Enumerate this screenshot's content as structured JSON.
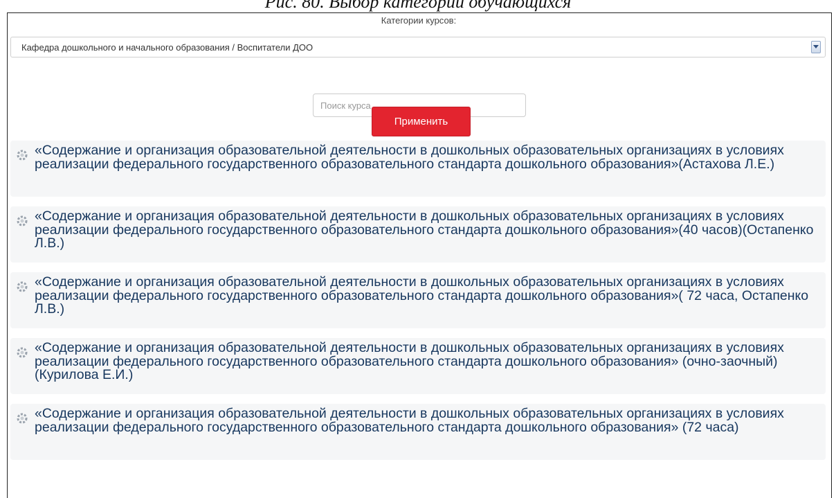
{
  "caption": "Рис. 80. Выбор категорий обучающихся",
  "filter": {
    "label": "Категории курсов:",
    "selected": "Кафедра дошкольного и начального образования / Воспитатели ДОО"
  },
  "search": {
    "placeholder": "Поиск курса",
    "value": ""
  },
  "apply_label": "Применить",
  "courses": [
    {
      "title": "«Содержание и организация образовательной деятельности в дошкольных образовательных организациях в условиях реализации федерального государственного образовательного стандарта дошкольного образования»(Астахова Л.Е.)"
    },
    {
      "title": "«Содержание и организация образовательной деятельности в дошкольных образовательных организациях в условиях реализации федерального государственного образовательного стандарта дошкольного образования»(40 часов)(Остапенко Л.В.)"
    },
    {
      "title": "«Содержание и организация образовательной деятельности в дошкольных образовательных организациях в условиях реализации федерального государственного образовательного стандарта дошкольного образования»( 72 часа, Остапенко Л.В.)"
    },
    {
      "title": "«Содержание и организация образовательной деятельности в дошкольных образовательных организациях в условиях реализации федерального государственного образовательного стандарта дошкольного образования» (очно-заочный) (Курилова Е.И.)"
    },
    {
      "title": "«Содержание и организация образовательной деятельности в дошкольных образовательных организациях в условиях реализации федерального государственного образовательного стандарта дошкольного образования» (72 часа)"
    }
  ],
  "icons": {
    "course_item": "gear-icon",
    "select_toggle": "chevron-down-icon"
  },
  "colors": {
    "accent_button": "#e3242f",
    "course_title": "#17375e",
    "item_background": "#f5f6f7"
  }
}
